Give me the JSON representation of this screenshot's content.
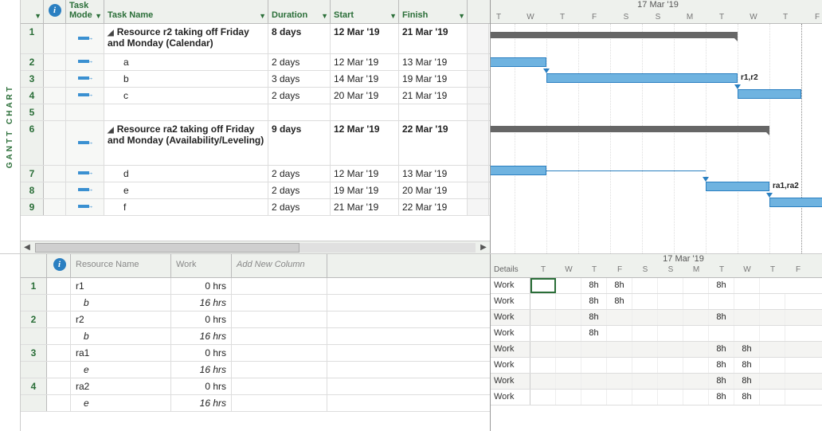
{
  "gantt_label": "GANTT CHART",
  "task_headers": {
    "mode": "Task Mode",
    "name": "Task Name",
    "duration": "Duration",
    "start": "Start",
    "finish": "Finish"
  },
  "dropdown_glyph": "▼",
  "triangle_glyph": "◢",
  "tasks": [
    {
      "id": "1",
      "summary": true,
      "name": "Resource r2 taking off Friday and Monday (Calendar)",
      "duration": "8 days",
      "start": "12 Mar '19",
      "finish": "21 Mar '19",
      "rowclass": "dbl"
    },
    {
      "id": "2",
      "summary": false,
      "name": "a",
      "duration": "2 days",
      "start": "12 Mar '19",
      "finish": "13 Mar '19"
    },
    {
      "id": "3",
      "summary": false,
      "name": "b",
      "duration": "3 days",
      "start": "14 Mar '19",
      "finish": "19 Mar '19"
    },
    {
      "id": "4",
      "summary": false,
      "name": "c",
      "duration": "2 days",
      "start": "20 Mar '19",
      "finish": "21 Mar '19"
    },
    {
      "id": "5",
      "blank": true
    },
    {
      "id": "6",
      "summary": true,
      "name": "Resource ra2 taking off Friday and Monday (Availability/Leveling)",
      "duration": "9 days",
      "start": "12 Mar '19",
      "finish": "22 Mar '19",
      "rowclass": "tpl"
    },
    {
      "id": "7",
      "summary": false,
      "name": "d",
      "duration": "2 days",
      "start": "12 Mar '19",
      "finish": "13 Mar '19"
    },
    {
      "id": "8",
      "summary": false,
      "name": "e",
      "duration": "2 days",
      "start": "19 Mar '19",
      "finish": "20 Mar '19"
    },
    {
      "id": "9",
      "summary": false,
      "name": "f",
      "duration": "2 days",
      "start": "21 Mar '19",
      "finish": "22 Mar '19"
    }
  ],
  "timeline": {
    "label": "17 Mar '19",
    "days": [
      "T",
      "W",
      "T",
      "F",
      "S",
      "S",
      "M",
      "T",
      "W",
      "T",
      "F"
    ]
  },
  "bar_labels": {
    "r1r2": "r1,r2",
    "ra1ra2": "ra1,ra2"
  },
  "resource_headers": {
    "name": "Resource Name",
    "work": "Work",
    "add": "Add New Column"
  },
  "resources": [
    {
      "id": "1",
      "name": "r1",
      "work": "0 hrs"
    },
    {
      "assign": true,
      "name": "b",
      "work": "16 hrs"
    },
    {
      "id": "2",
      "name": "r2",
      "work": "0 hrs"
    },
    {
      "assign": true,
      "name": "b",
      "work": "16 hrs"
    },
    {
      "id": "3",
      "name": "ra1",
      "work": "0 hrs"
    },
    {
      "assign": true,
      "name": "e",
      "work": "16 hrs"
    },
    {
      "id": "4",
      "name": "ra2",
      "work": "0 hrs"
    },
    {
      "assign": true,
      "name": "e",
      "work": "16 hrs"
    }
  ],
  "usage": {
    "details_label": "Details",
    "work_label": "Work",
    "rows": [
      {
        "shade": false,
        "selected": 0,
        "cells": [
          "",
          "",
          "8h",
          "8h",
          "",
          "",
          "",
          "8h",
          ""
        ]
      },
      {
        "shade": false,
        "cells": [
          "",
          "",
          "8h",
          "8h",
          "",
          "",
          "",
          "",
          "",
          ""
        ]
      },
      {
        "shade": true,
        "cells": [
          "",
          "",
          "8h",
          "",
          "",
          "",
          "",
          "8h",
          "",
          ""
        ]
      },
      {
        "shade": false,
        "cells": [
          "",
          "",
          "8h",
          "",
          "",
          "",
          "",
          "",
          "",
          ""
        ]
      },
      {
        "shade": true,
        "cells": [
          "",
          "",
          "",
          "",
          "",
          "",
          "",
          "8h",
          "8h",
          ""
        ]
      },
      {
        "shade": false,
        "cells": [
          "",
          "",
          "",
          "",
          "",
          "",
          "",
          "8h",
          "8h",
          ""
        ]
      },
      {
        "shade": true,
        "cells": [
          "",
          "",
          "",
          "",
          "",
          "",
          "",
          "8h",
          "8h",
          ""
        ]
      },
      {
        "shade": false,
        "cells": [
          "",
          "",
          "",
          "",
          "",
          "",
          "",
          "8h",
          "8h",
          ""
        ]
      }
    ]
  },
  "usage_timeline": {
    "label": "17 Mar '19",
    "days": [
      "T",
      "W",
      "T",
      "F",
      "S",
      "S",
      "M",
      "T",
      "W",
      "T",
      "F"
    ]
  }
}
